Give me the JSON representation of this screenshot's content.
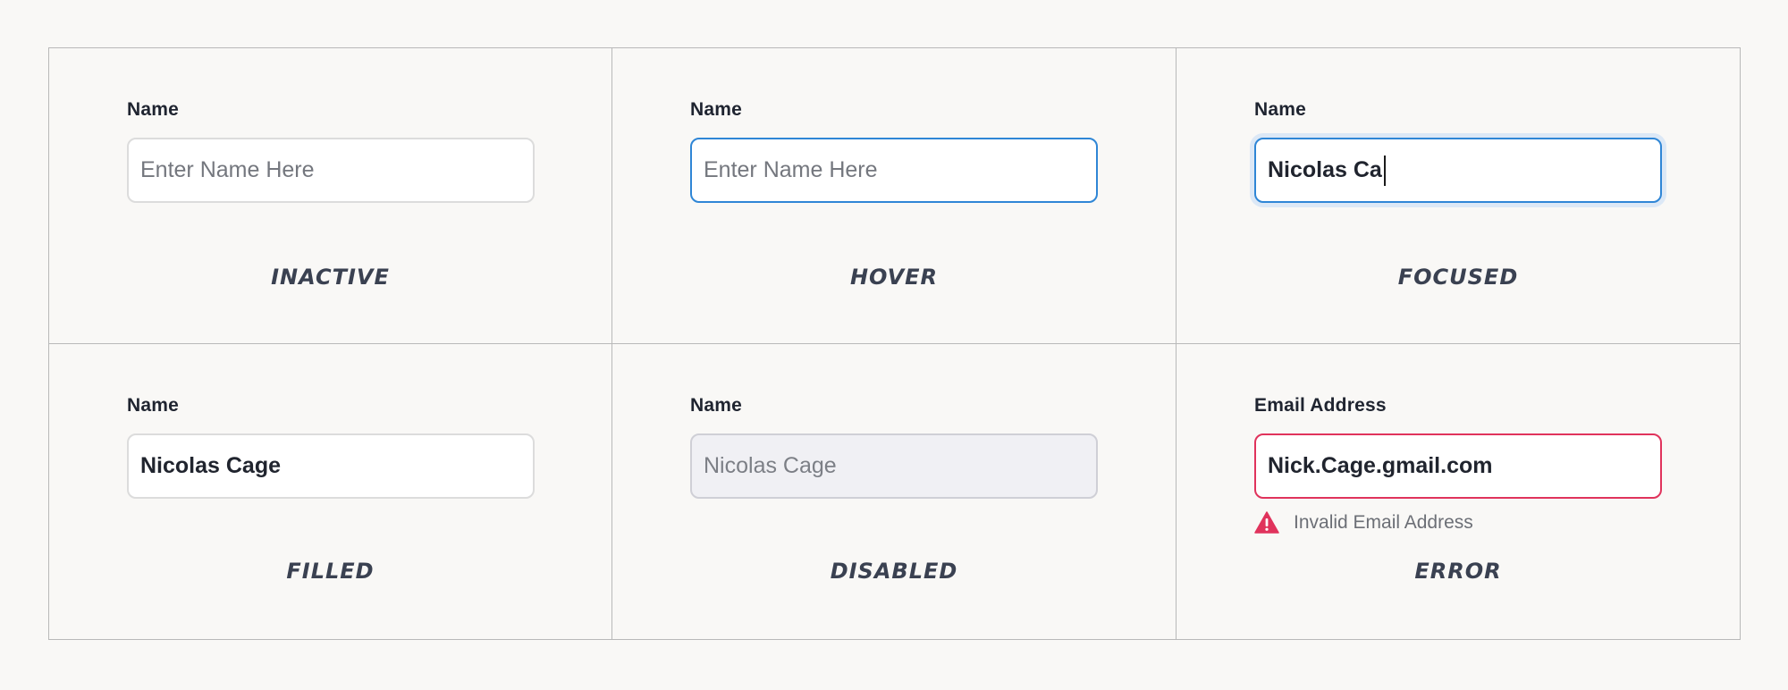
{
  "colors": {
    "background": "#f9f8f6",
    "grid_border": "#b9b9b9",
    "hover_border": "#2f86d6",
    "focus_ring": "#dce8f6",
    "error_accent": "#e0335c",
    "disabled_fill": "#f0f0f4",
    "caption_text": "#3a4151"
  },
  "states": [
    {
      "caption": "INACTIVE",
      "label": "Name",
      "placeholder": "Enter Name Here"
    },
    {
      "caption": "HOVER",
      "label": "Name",
      "placeholder": "Enter Name Here"
    },
    {
      "caption": "FOCUSED",
      "label": "Name",
      "value": "Nicolas Ca"
    },
    {
      "caption": "FILLED",
      "label": "Name",
      "value": "Nicolas Cage"
    },
    {
      "caption": "DISABLED",
      "label": "Name",
      "value": "Nicolas Cage"
    },
    {
      "caption": "ERROR",
      "label": "Email Address",
      "value": "Nick.Cage.gmail.com",
      "error_message": "Invalid Email Address",
      "error_icon": "warning-triangle-icon"
    }
  ]
}
